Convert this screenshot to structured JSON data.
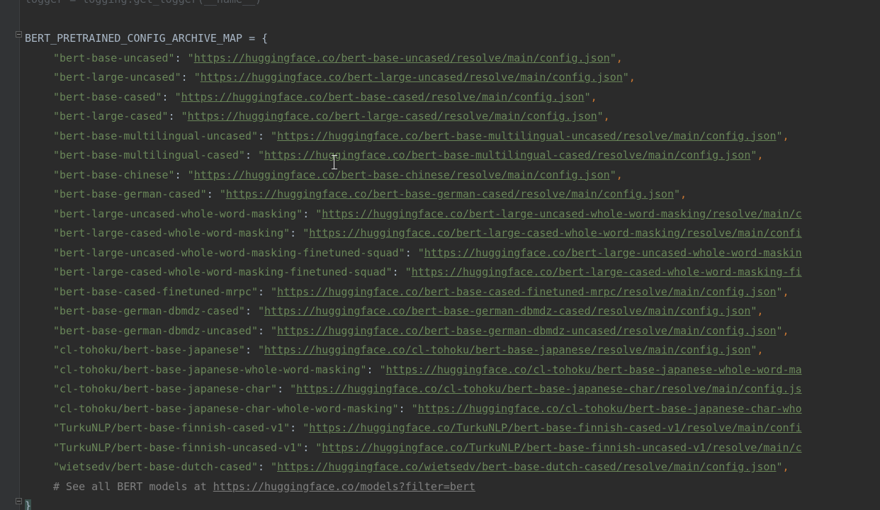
{
  "editor": {
    "top_partial_line": "logger = logging.get_logger(__name__)",
    "map_name": "BERT_PRETRAINED_CONFIG_ARCHIVE_MAP",
    "assign_open": " = {",
    "closing_brace": "}",
    "comment_prefix": "# See all BERT models at ",
    "comment_url": "https://huggingface.co/models?filter=bert",
    "entries": [
      {
        "key": "\"bert-base-uncased\"",
        "url": "https://huggingface.co/bert-base-uncased/resolve/main/config.json",
        "tail": "\","
      },
      {
        "key": "\"bert-large-uncased\"",
        "url": "https://huggingface.co/bert-large-uncased/resolve/main/config.json",
        "tail": "\","
      },
      {
        "key": "\"bert-base-cased\"",
        "url": "https://huggingface.co/bert-base-cased/resolve/main/config.json",
        "tail": "\","
      },
      {
        "key": "\"bert-large-cased\"",
        "url": "https://huggingface.co/bert-large-cased/resolve/main/config.json",
        "tail": "\","
      },
      {
        "key": "\"bert-base-multilingual-uncased\"",
        "url": "https://huggingface.co/bert-base-multilingual-uncased/resolve/main/config.json",
        "tail": "\","
      },
      {
        "key": "\"bert-base-multilingual-cased\"",
        "url": "https://huggingface.co/bert-base-multilingual-cased/resolve/main/config.json",
        "tail": "\","
      },
      {
        "key": "\"bert-base-chinese\"",
        "url": "https://huggingface.co/bert-base-chinese/resolve/main/config.json",
        "tail": "\","
      },
      {
        "key": "\"bert-base-german-cased\"",
        "url": "https://huggingface.co/bert-base-german-cased/resolve/main/config.json",
        "tail": "\","
      },
      {
        "key": "\"bert-large-uncased-whole-word-masking\"",
        "url": "https://huggingface.co/bert-large-uncased-whole-word-masking/resolve/main/c",
        "tail": ""
      },
      {
        "key": "\"bert-large-cased-whole-word-masking\"",
        "url": "https://huggingface.co/bert-large-cased-whole-word-masking/resolve/main/confi",
        "tail": ""
      },
      {
        "key": "\"bert-large-uncased-whole-word-masking-finetuned-squad\"",
        "url": "https://huggingface.co/bert-large-uncased-whole-word-maskin",
        "tail": ""
      },
      {
        "key": "\"bert-large-cased-whole-word-masking-finetuned-squad\"",
        "url": "https://huggingface.co/bert-large-cased-whole-word-masking-fi",
        "tail": ""
      },
      {
        "key": "\"bert-base-cased-finetuned-mrpc\"",
        "url": "https://huggingface.co/bert-base-cased-finetuned-mrpc/resolve/main/config.json",
        "tail": "\","
      },
      {
        "key": "\"bert-base-german-dbmdz-cased\"",
        "url": "https://huggingface.co/bert-base-german-dbmdz-cased/resolve/main/config.json",
        "tail": "\","
      },
      {
        "key": "\"bert-base-german-dbmdz-uncased\"",
        "url": "https://huggingface.co/bert-base-german-dbmdz-uncased/resolve/main/config.json",
        "tail": "\","
      },
      {
        "key": "\"cl-tohoku/bert-base-japanese\"",
        "url": "https://huggingface.co/cl-tohoku/bert-base-japanese/resolve/main/config.json",
        "tail": "\","
      },
      {
        "key": "\"cl-tohoku/bert-base-japanese-whole-word-masking\"",
        "url": "https://huggingface.co/cl-tohoku/bert-base-japanese-whole-word-ma",
        "tail": ""
      },
      {
        "key": "\"cl-tohoku/bert-base-japanese-char\"",
        "url": "https://huggingface.co/cl-tohoku/bert-base-japanese-char/resolve/main/config.js",
        "tail": ""
      },
      {
        "key": "\"cl-tohoku/bert-base-japanese-char-whole-word-masking\"",
        "url": "https://huggingface.co/cl-tohoku/bert-base-japanese-char-who",
        "tail": ""
      },
      {
        "key": "\"TurkuNLP/bert-base-finnish-cased-v1\"",
        "url": "https://huggingface.co/TurkuNLP/bert-base-finnish-cased-v1/resolve/main/confi",
        "tail": ""
      },
      {
        "key": "\"TurkuNLP/bert-base-finnish-uncased-v1\"",
        "url": "https://huggingface.co/TurkuNLP/bert-base-finnish-uncased-v1/resolve/main/c",
        "tail": ""
      },
      {
        "key": "\"wietsedv/bert-base-dutch-cased\"",
        "url": "https://huggingface.co/wietsedv/bert-base-dutch-cased/resolve/main/config.json",
        "tail": "\","
      }
    ]
  },
  "colors": {
    "background": "#2b2b2b",
    "string": "#6a8759",
    "identifier": "#a9b7c6",
    "comment": "#808080",
    "punctuation": "#cc7832"
  }
}
